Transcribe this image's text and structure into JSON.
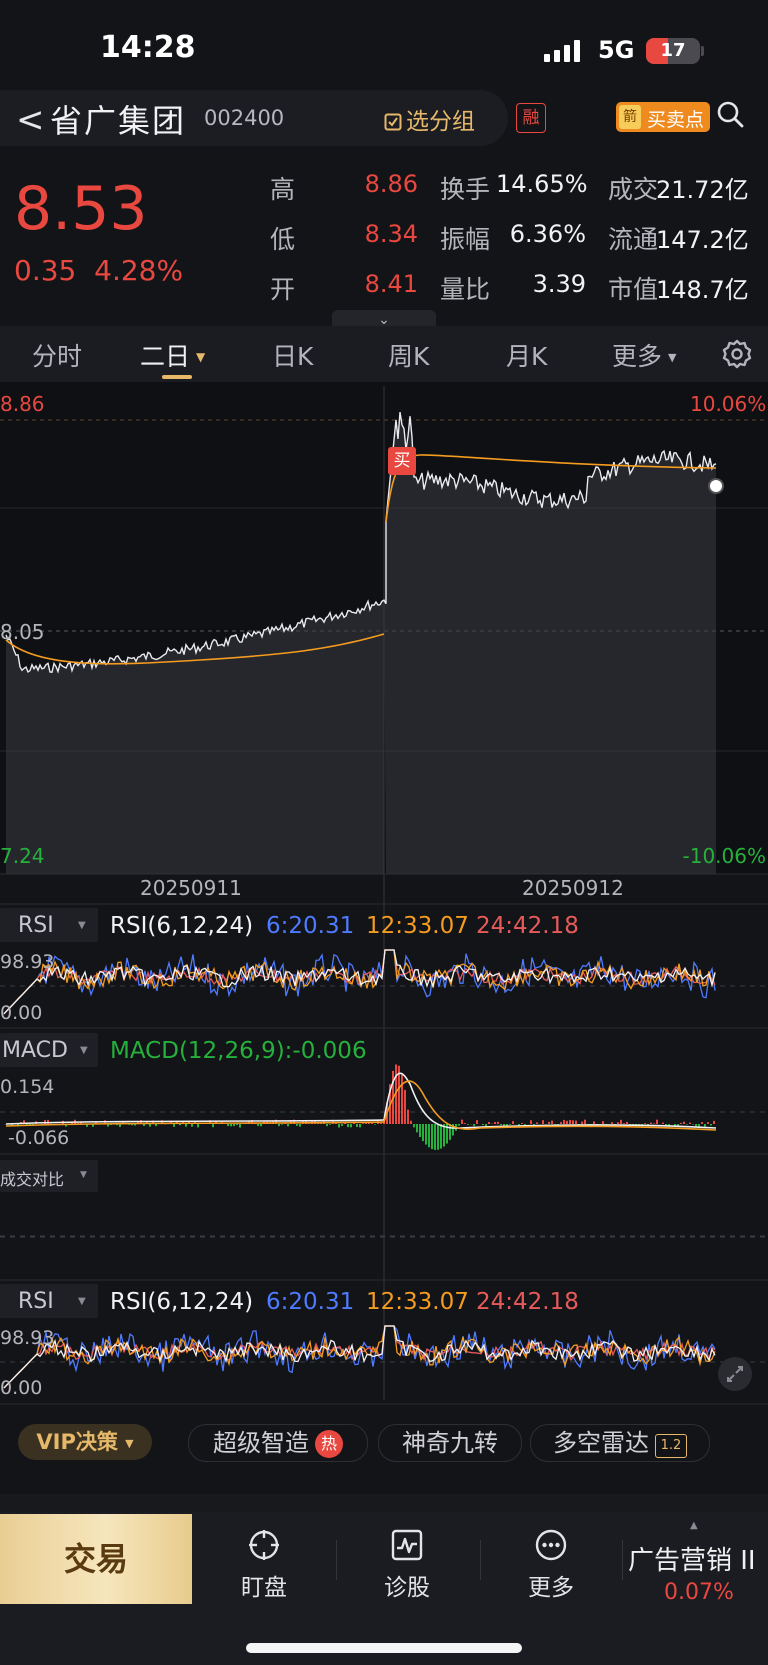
{
  "status_bar": {
    "time": "14:28",
    "network": "5G",
    "battery": "17"
  },
  "header": {
    "back": "<",
    "stock_name": "省广集团",
    "stock_code": "002400",
    "watchlist_label": "选分组",
    "margin_badge": "融",
    "signal_icon": "箭",
    "signal_label": "买卖点"
  },
  "quote": {
    "price": "8.53",
    "change": "0.35",
    "change_pct": "4.28%",
    "stats": [
      {
        "label": "高",
        "value": "8.86"
      },
      {
        "label": "低",
        "value": "8.34"
      },
      {
        "label": "开",
        "value": "8.41"
      },
      {
        "label": "换手",
        "value": "14.65%"
      },
      {
        "label": "振幅",
        "value": "6.36%"
      },
      {
        "label": "量比",
        "value": "3.39"
      },
      {
        "label": "成交",
        "value": "21.72亿"
      },
      {
        "label": "流通",
        "value": "147.2亿"
      },
      {
        "label": "市值",
        "value": "148.7亿"
      }
    ]
  },
  "tabs": [
    {
      "label": "分时"
    },
    {
      "label": "二日",
      "active": true
    },
    {
      "label": "日K"
    },
    {
      "label": "周K"
    },
    {
      "label": "月K"
    },
    {
      "label": "更多"
    }
  ],
  "chart": {
    "price_high": "8.86",
    "price_mid": "8.05",
    "price_low": "7.24",
    "pct_high": "10.06%",
    "pct_low": "-10.06%",
    "date_left": "20250911",
    "date_right": "20250912",
    "buy_marker": "买"
  },
  "indicators": {
    "rsi_name": "RSI",
    "rsi_params": "RSI(6,12,24)",
    "rsi_6": "6:20.31",
    "rsi_12": "12:33.07",
    "rsi_24": "24:42.18",
    "rsi_top": "98.93",
    "rsi_bottom": "0.00",
    "macd_name": "MACD",
    "macd_params": "MACD(12,26,9):-0.006",
    "macd_top": "0.154",
    "macd_bottom": "-0.066",
    "volume_compare": "成交对比"
  },
  "features": {
    "vip": "VIP决策",
    "smart": "超级智造",
    "hot": "热",
    "nine": "神奇九转",
    "radar": "多空雷达",
    "ai_badge": "1.2"
  },
  "bottom_nav": {
    "trade": "交易",
    "watch": "盯盘",
    "diagnose": "诊股",
    "more": "更多",
    "ad_name": "广告营销 II",
    "ad_pct": "0.07%"
  },
  "colors": {
    "up": "#e8483f",
    "down": "#25b13c",
    "accent_gold": "#e6b869",
    "avg_line": "#f39c1f",
    "rsi6": "#4e7bff",
    "rsi12": "#f39c1f",
    "rsi24": "#e85a5a"
  }
}
